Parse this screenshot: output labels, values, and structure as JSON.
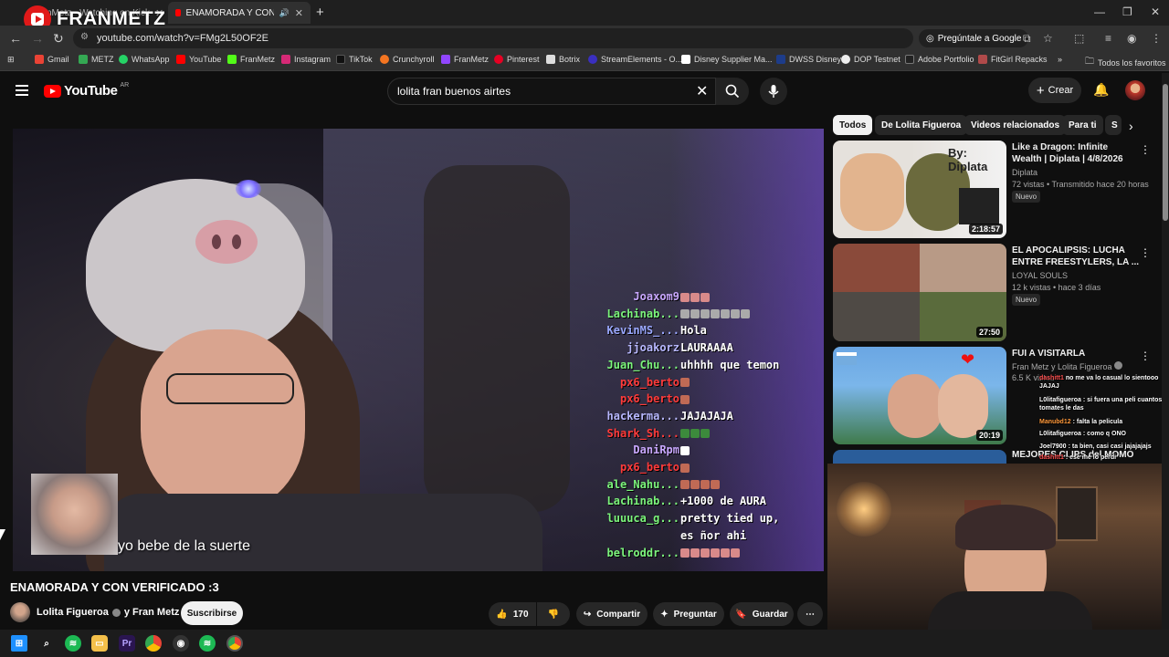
{
  "browser": {
    "tabs": [
      {
        "label": "FranMetz - Watching on Kick"
      },
      {
        "label": "ENAMORADA Y CON VERIFICADO :3"
      }
    ],
    "url": "youtube.com/watch?v=FMg2L50OF2E",
    "ask_google": "Pregúntale a Google",
    "bookmarks": [
      "Gmail",
      "METZ",
      "WhatsApp",
      "YouTube",
      "FranMetz",
      "Instagram",
      "TikTok",
      "Crunchyroll",
      "FranMetz",
      "Pinterest",
      "Botrix",
      "StreamElements - O...",
      "Disney Supplier Ma...",
      "DWSS Disney",
      "DOP Testnet",
      "Adobe Portfolio",
      "FitGirl Repacks"
    ],
    "all_favorites": "Todos los favoritos"
  },
  "overlay_logo": "FRANMETZ",
  "header": {
    "logo_text": "YouTube",
    "logo_country": "AR",
    "search_query": "lolita fran buenos airtes",
    "create_label": "Crear"
  },
  "player": {
    "kid_caption": "yo bebe de la suerte",
    "chat": [
      {
        "user": "Joaxom9",
        "msg": "",
        "color": "#c9a8ff",
        "emotes": [
          "#d88a8a",
          "#d88a8a",
          "#d88a8a"
        ]
      },
      {
        "user": "Lachinab...",
        "msg": "",
        "color": "#7cf57c",
        "emotes": [
          "#aaaaaa",
          "#aaaaaa",
          "#aaaaaa",
          "#aaaaaa",
          "#aaaaaa",
          "#aaaaaa",
          "#aaaaaa"
        ]
      },
      {
        "user": "KevinMS_...",
        "msg": "Hola",
        "color": "#9aa8ff",
        "emotes": []
      },
      {
        "user": "jjoakorz",
        "msg": "LAURAAAA",
        "color": "#b8b8ff",
        "emotes": []
      },
      {
        "user": "Juan_Chu...",
        "msg": "uhhhh que temon",
        "color": "#7cf57c",
        "emotes": []
      },
      {
        "user": "px6_berto",
        "msg": "",
        "color": "#ff3b3b",
        "emotes": [
          "#c06a55"
        ]
      },
      {
        "user": "px6_berto",
        "msg": "",
        "color": "#ff3b3b",
        "emotes": [
          "#c06a55"
        ]
      },
      {
        "user": "hackerma...",
        "msg": "JAJAJAJA",
        "color": "#b8b8ff",
        "emotes": []
      },
      {
        "user": "Shark_Sh...",
        "msg": "",
        "color": "#ff3b3b",
        "emotes": [
          "#3c8a3c",
          "#3c8a3c",
          "#3c8a3c"
        ]
      },
      {
        "user": "DaniRpm",
        "msg": "",
        "color": "#c9a8ff",
        "emotes": [
          "#ffffff"
        ]
      },
      {
        "user": "px6_berto",
        "msg": "",
        "color": "#ff3b3b",
        "emotes": [
          "#c06a55"
        ]
      },
      {
        "user": "ale_Nahu...",
        "msg": "",
        "color": "#7cf57c",
        "emotes": [
          "#c06a55",
          "#c06a55",
          "#c06a55",
          "#c06a55"
        ]
      },
      {
        "user": "Lachinab...",
        "msg": "+1000 de AURA",
        "color": "#7cf57c",
        "emotes": []
      },
      {
        "user": "luuuca_g...",
        "msg": "pretty tied up,",
        "color": "#7cf57c",
        "emotes": []
      },
      {
        "user": "",
        "msg": "es ñor ahi",
        "color": "#7cf57c",
        "emotes": []
      },
      {
        "user": "belroddr...",
        "msg": "",
        "color": "#7cf57c",
        "emotes": [
          "#d88a8a",
          "#d88a8a",
          "#d88a8a",
          "#d88a8a",
          "#d88a8a",
          "#d88a8a"
        ]
      }
    ]
  },
  "video": {
    "title": "ENAMORADA Y CON VERIFICADO :3",
    "channel": "Lolita Figueroa",
    "channel_collab": "y Fran Metz",
    "subscribe_label": "Suscribirse",
    "likes": "170",
    "share_label": "Compartir",
    "ask_label": "Preguntar",
    "save_label": "Guardar"
  },
  "sidebar": {
    "chips": [
      "Todos",
      "De Lolita Figueroa",
      "Videos relacionados",
      "Para ti",
      "S"
    ],
    "recommendations": [
      {
        "title": "Like a Dragon: Infinite Wealth | Diplata | 4/8/2026",
        "channel": "Diplata",
        "meta": "72 vistas • Transmitido hace 20 horas",
        "badge": "Nuevo",
        "duration": "2:18:57",
        "thumb_overlay": "By: Diplata"
      },
      {
        "title": "EL APOCALIPSIS: LUCHA ENTRE FREESTYLERS, LA ...",
        "channel": "LOYAL SOULS",
        "meta": "12 k vistas • hace 3 días",
        "badge": "Nuevo",
        "duration": "27:50"
      },
      {
        "title": "FUI A VISITARLA",
        "channel": "Fran Metz y Lolita Figueroa",
        "meta": "6.5 K vistas",
        "duration": "20:19"
      },
      {
        "title": "MEJORES CLIPS del MOMO"
      }
    ]
  },
  "stream_chat": [
    {
      "user": "dashitt1",
      "msg": "no me va lo casual lo sientooo JAJAJ",
      "color": "#ff5050"
    },
    {
      "user": "L0litafigueroa",
      "msg": ": si fuera una peli cuantos tomates le das",
      "color": "#ffffff"
    },
    {
      "user": "Manubd12",
      "msg": ": falta la pelicula",
      "color": "#ff9a3c"
    },
    {
      "user": "L0litafigueroa",
      "msg": ": como q ONO",
      "color": "#ffffff"
    },
    {
      "user": "Joel7900",
      "msg": ": ta bien, casi casi jajajajajs",
      "color": "#ffffff"
    },
    {
      "user": "dashitt1",
      "msg": ": ese me lo perdi",
      "color": "#ff5050"
    }
  ]
}
